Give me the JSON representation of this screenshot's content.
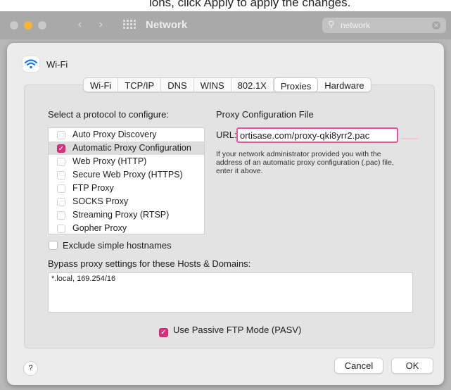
{
  "top_strip": {
    "text": "ions, click Apply to apply the changes."
  },
  "window": {
    "title": "Network",
    "back_glyph": "‹",
    "forward_glyph": "›",
    "search": {
      "value": "network",
      "icon": "search-icon"
    }
  },
  "sheet": {
    "interface_name": "Wi-Fi",
    "tabs": [
      {
        "label": "Wi-Fi"
      },
      {
        "label": "TCP/IP"
      },
      {
        "label": "DNS"
      },
      {
        "label": "WINS"
      },
      {
        "label": "802.1X"
      },
      {
        "label": "Proxies",
        "active": true
      },
      {
        "label": "Hardware"
      }
    ],
    "select_protocol_label": "Select a protocol to configure:",
    "protocols": [
      {
        "label": "Auto Proxy Discovery",
        "checked": false
      },
      {
        "label": "Automatic Proxy Configuration",
        "checked": true,
        "selected": true
      },
      {
        "label": "Web Proxy (HTTP)",
        "checked": false
      },
      {
        "label": "Secure Web Proxy (HTTPS)",
        "checked": false
      },
      {
        "label": "FTP Proxy",
        "checked": false
      },
      {
        "label": "SOCKS Proxy",
        "checked": false
      },
      {
        "label": "Streaming Proxy (RTSP)",
        "checked": false
      },
      {
        "label": "Gopher Proxy",
        "checked": false
      }
    ],
    "proxy_config_heading": "Proxy Configuration File",
    "url_label": "URL:",
    "url_value": "ortisase.com/proxy-qki8yrr2.pac",
    "help_text": "If your network administrator provided you with the address of an automatic proxy configuration (.pac) file, enter it above.",
    "exclude_simple_hostnames": {
      "label": "Exclude simple hostnames",
      "checked": false
    },
    "bypass_label": "Bypass proxy settings for these Hosts & Domains:",
    "bypass_value": "*.local, 169.254/16",
    "passive_ftp": {
      "label": "Use Passive FTP Mode (PASV)",
      "checked": true
    },
    "help_button": "?",
    "cancel_label": "Cancel",
    "ok_label": "OK"
  },
  "colors": {
    "accent": "#d6307f",
    "url_focus": "#e8559a"
  }
}
